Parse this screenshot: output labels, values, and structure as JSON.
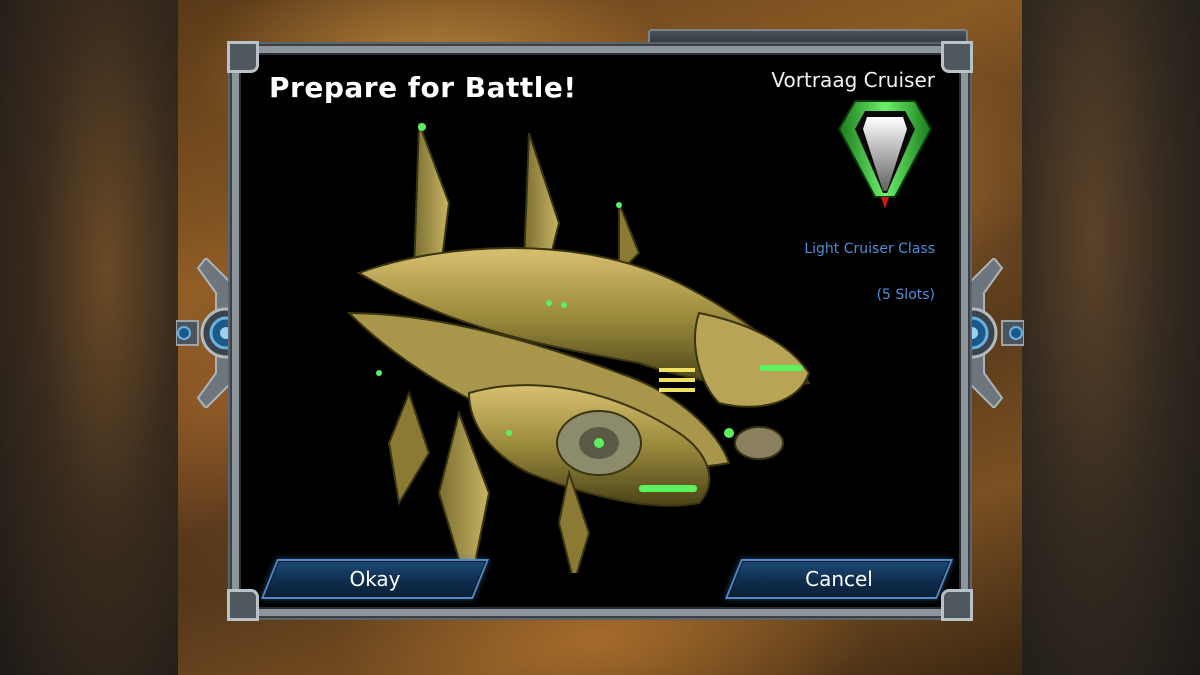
{
  "dialog": {
    "title": "Prepare for Battle!",
    "ship_name": "Vortraag Cruiser",
    "ship_class": "Light Cruiser Class",
    "ship_slots": "(5 Slots)",
    "emblem_icon": "vortraag-faction-emblem",
    "ship_image": "vortraag-cruiser-ship"
  },
  "buttons": {
    "okay_label": "Okay",
    "cancel_label": "Cancel"
  },
  "colors": {
    "accent_text": "#4d8fd8",
    "button_border": "#4e8ac4",
    "emblem_green": "#3cc83c"
  }
}
